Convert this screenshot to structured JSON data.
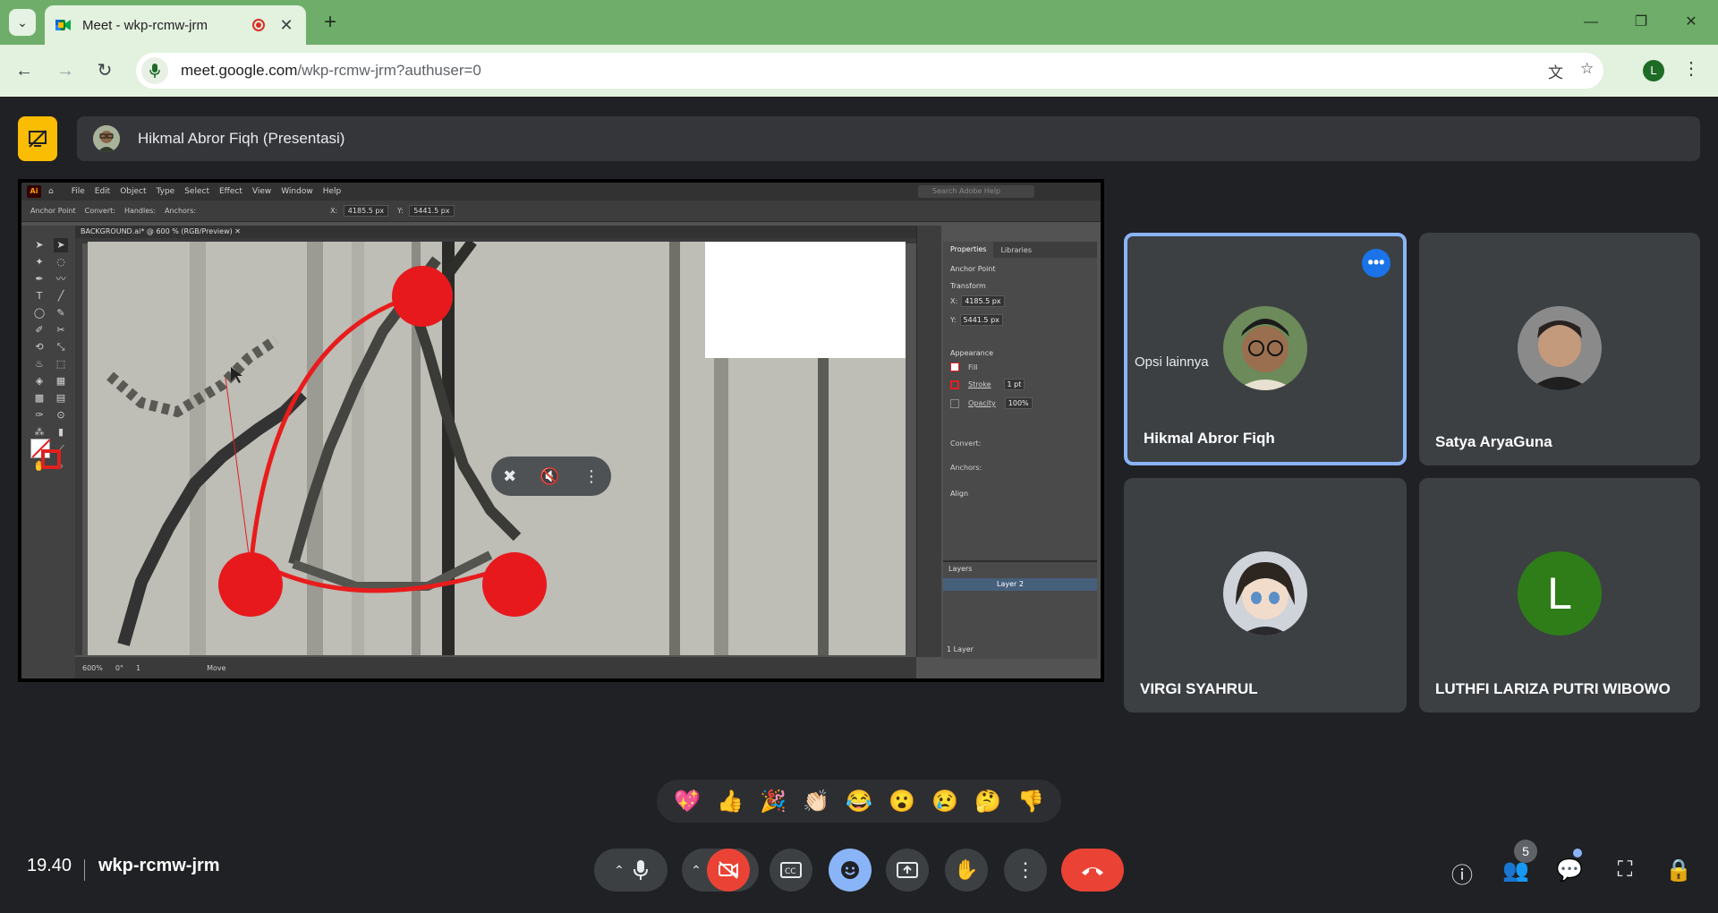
{
  "browser": {
    "tab_title": "Meet - wkp-rcmw-jrm",
    "url_host": "meet.google.com",
    "url_path": "/wkp-rcmw-jrm?authuser=0",
    "profile_initial": "L"
  },
  "presentation": {
    "banner_label": "Hikmal Abror Fiqh (Presentasi)"
  },
  "illustrator": {
    "menus": [
      "File",
      "Edit",
      "Object",
      "Type",
      "Select",
      "Effect",
      "View",
      "Window",
      "Help"
    ],
    "search_placeholder": "Search Adobe Help",
    "control_label": "Anchor Point",
    "convert_label": "Convert:",
    "handles_label": "Handles:",
    "anchors_label": "Anchors:",
    "x_value": "4185.5 px",
    "y_value": "5441.5 px",
    "doc_tab": "BACKGROUND.ai* @ 600 % (RGB/Preview)",
    "zoom": "600%",
    "rotation": "0°",
    "artboard": "1",
    "status_tool": "Move",
    "panel_tabs": [
      "Properties",
      "Libraries"
    ],
    "panel_selection": "Anchor Point",
    "transform_label": "Transform",
    "appearance_label": "Appearance",
    "fill_label": "Fill",
    "stroke_label": "Stroke",
    "stroke_weight": "1 pt",
    "opacity_label": "Opacity",
    "opacity_value": "100%",
    "convert_panel": "Convert:",
    "anchors_panel": "Anchors:",
    "align_label": "Align",
    "layers_label": "Layers",
    "layer_name": "Layer 2",
    "layers_count": "1 Layer"
  },
  "participants": [
    {
      "name": "Hikmal Abror Fiqh",
      "tooltip": "Opsi lainnya"
    },
    {
      "name": "Satya AryaGuna"
    },
    {
      "name": "VIRGI SYAHRUL"
    },
    {
      "name": "LUTHFI LARIZA PUTRI WIBOWO",
      "initial": "L",
      "color": "#2e7d18"
    }
  ],
  "reactions": [
    "💖",
    "👍",
    "🎉",
    "👏🏻",
    "😂",
    "😮",
    "😢",
    "🤔",
    "👎"
  ],
  "footer": {
    "time": "19.40",
    "meeting_code": "wkp-rcmw-jrm",
    "people_count": "5"
  },
  "colors": {
    "tabstrip": "#6fae6a",
    "toolbar": "#e3f1df",
    "meet_bg": "#202124",
    "end_call": "#ea4335",
    "active_tile_border": "#8ab4f8"
  }
}
